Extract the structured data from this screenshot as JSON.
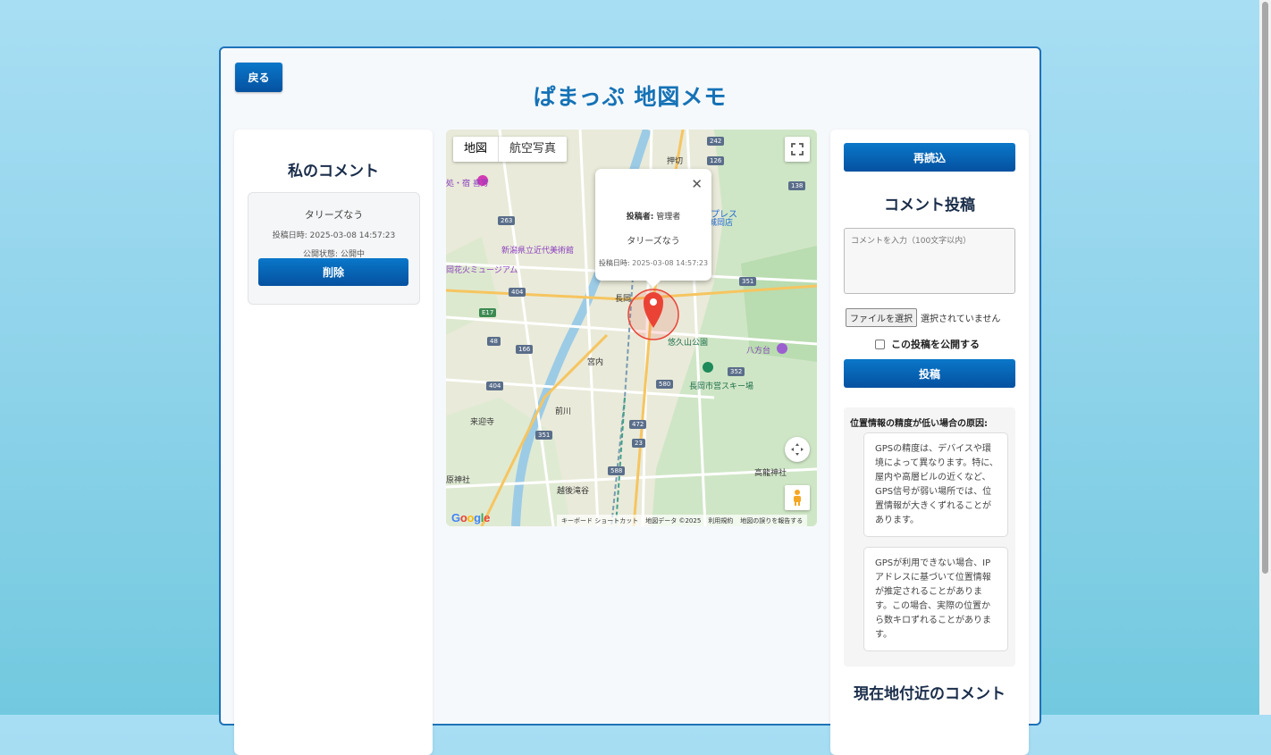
{
  "header": {
    "back_label": "戻る",
    "title": "ぱまっぷ 地図メモ"
  },
  "my_comments": {
    "heading": "私のコメント",
    "items": [
      {
        "text": "タリーズなう",
        "date": "投稿日時: 2025-03-08 14:57:23",
        "status": "公開状態: 公開中",
        "delete_label": "削除"
      }
    ]
  },
  "map": {
    "type_buttons": [
      "地図",
      "航空写真"
    ],
    "info_window": {
      "poster_label": "投稿者:",
      "poster": "管理者",
      "text": "タリーズなう",
      "date_label": "投稿日時:",
      "date": "2025-03-08 14:57:23"
    },
    "footer": [
      "キーボード ショートカット",
      "地図データ ©2025",
      "利用規約",
      "地図の誤りを報告する"
    ],
    "logo": "Google",
    "place_labels": [
      "押切",
      "新潟県立近代美術館",
      "岡花火ミュージアム",
      "長岡",
      "悠久山公園",
      "八方台",
      "宮内",
      "長岡市営スキー場",
      "前川",
      "来迎寺",
      "高龍神社",
      "越後滝谷",
      "原神社",
      "プレス",
      "城岡店",
      "処・宿 喜芳"
    ],
    "road_numbers": [
      "242",
      "126",
      "138",
      "263",
      "351",
      "404",
      "E17",
      "48",
      "166",
      "404",
      "580",
      "472",
      "23",
      "588",
      "351",
      "352"
    ]
  },
  "right": {
    "reload_label": "再読込",
    "post_heading": "コメント投稿",
    "comment_placeholder": "コメントを入力（100文字以内）",
    "file_button": "ファイルを選択",
    "file_status": "選択されていません",
    "public_label": "この投稿を公開する",
    "submit_label": "投稿",
    "accuracy_title": "位置情報の精度が低い場合の原因:",
    "accuracy_notes": [
      "GPSの精度は、デバイスや環境によって異なります。特に、屋内や高層ビルの近くなど、GPS信号が弱い場所では、位置情報が大きくずれることがあります。",
      "GPSが利用できない場合、IPアドレスに基づいて位置情報が推定されることがあります。この場合、実際の位置から数キロずれることがあります。"
    ],
    "nearby_heading": "現在地付近のコメント"
  },
  "colors": {
    "accent": "#0a6cc0",
    "title": "#1572b6",
    "marker": "#ea4335"
  }
}
